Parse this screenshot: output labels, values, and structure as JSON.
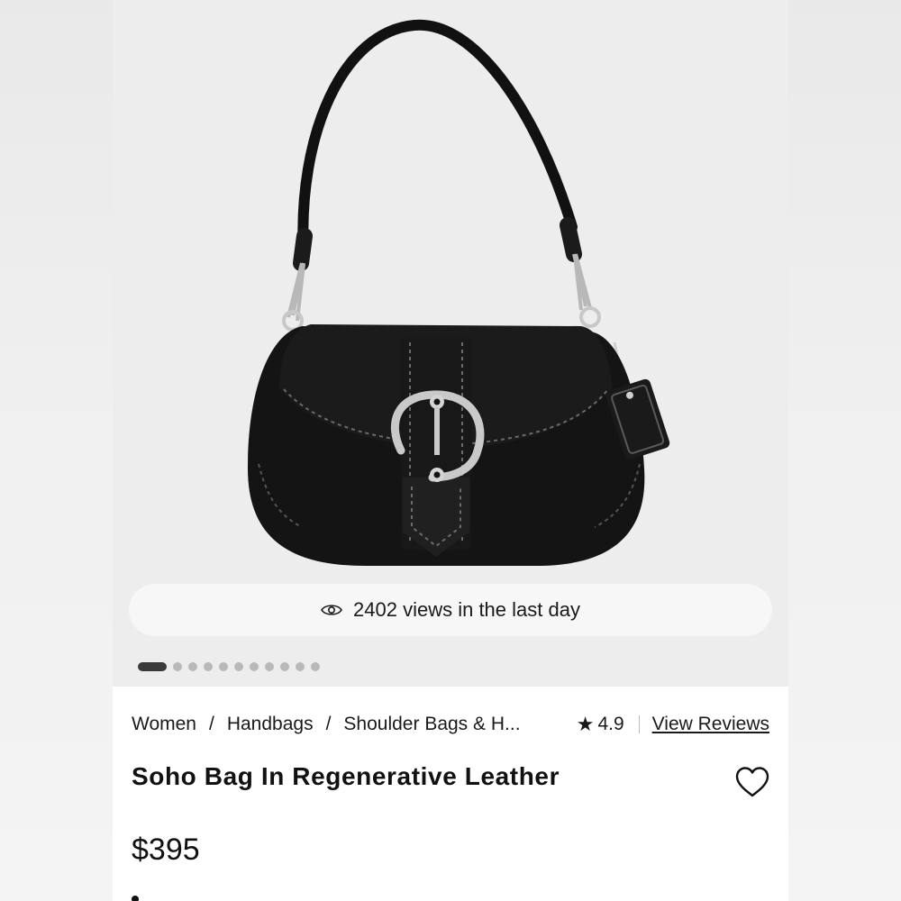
{
  "gallery": {
    "views_text": "2402 views in the last day",
    "slide_count": 11,
    "active_slide": 1
  },
  "breadcrumb": {
    "items": [
      "Women",
      "Handbags",
      "Shoulder Bags & H..."
    ],
    "separator": "/"
  },
  "rating": {
    "value": "4.9",
    "reviews_label": "View Reviews"
  },
  "product": {
    "title": "Soho Bag In Regenerative Leather",
    "price": "$395"
  },
  "colors": {
    "text": "#1a1a1a",
    "gallery_bg": "#ededed",
    "bag": "#111111",
    "hardware": "#c8c8c8"
  }
}
